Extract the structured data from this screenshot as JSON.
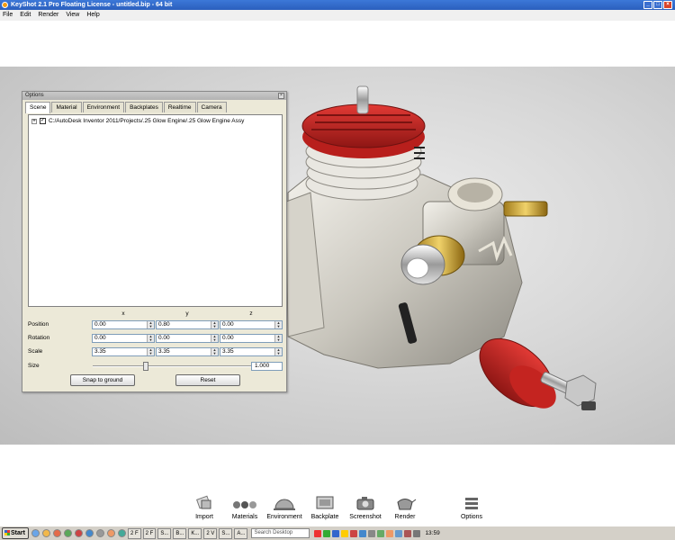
{
  "window": {
    "title": "KeyShot 2.1 Pro Floating License - untitled.bip - 64 bit"
  },
  "menu": [
    "File",
    "Edit",
    "Render",
    "View",
    "Help"
  ],
  "options": {
    "title": "Options",
    "tabs": [
      "Scene",
      "Material",
      "Environment",
      "Backplates",
      "Realtime",
      "Camera"
    ],
    "tree_item": {
      "expander": "+",
      "checked": "✓",
      "path": "C:/AutoDesk Inventor 2011/Projects/.25 Glow Engine/.25 Glow Engine Assy"
    },
    "axes": [
      "x",
      "y",
      "z"
    ],
    "fields": [
      {
        "label": "Position",
        "values": [
          "0.00",
          "0.80",
          "0.00"
        ]
      },
      {
        "label": "Rotation",
        "values": [
          "0.00",
          "0.00",
          "0.00"
        ]
      },
      {
        "label": "Scale",
        "values": [
          "3.35",
          "3.35",
          "3.35"
        ]
      }
    ],
    "size": {
      "label": "Size",
      "value": "1.000",
      "slider_fraction": 0.3
    },
    "buttons": {
      "snap": "Snap to ground",
      "reset": "Reset"
    }
  },
  "dock": [
    {
      "label": "Import",
      "icon": "import-icon"
    },
    {
      "label": "Materials",
      "icon": "materials-icon"
    },
    {
      "label": "Environment",
      "icon": "environment-icon"
    },
    {
      "label": "Backplate",
      "icon": "backplate-icon"
    },
    {
      "label": "Screenshot",
      "icon": "screenshot-icon"
    },
    {
      "label": "Render",
      "icon": "render-icon"
    },
    {
      "label": "Options",
      "icon": "options-icon"
    }
  ],
  "taskbar": {
    "start": "Start",
    "windows": [
      "2 F",
      "2 F",
      "S...",
      "B...",
      "K...",
      "2 V",
      "S...",
      "A..."
    ],
    "search_placeholder": "Search Desktop",
    "clock": "13:59"
  }
}
